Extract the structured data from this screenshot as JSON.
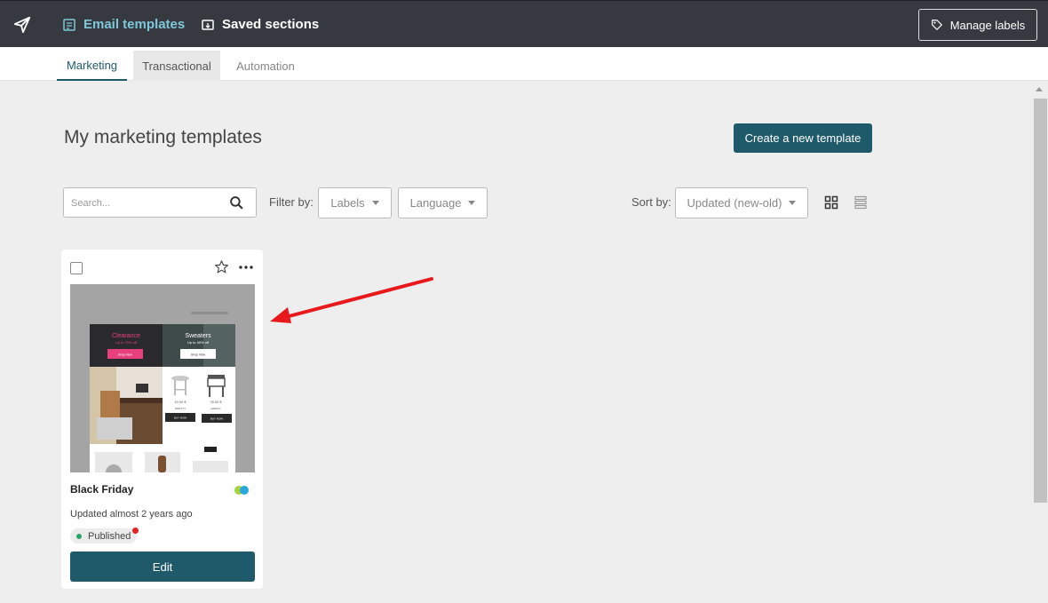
{
  "topbar": {
    "email_templates": "Email templates",
    "saved_sections": "Saved sections",
    "manage_labels": "Manage labels"
  },
  "tabs": [
    {
      "label": "Marketing",
      "active": true
    },
    {
      "label": "Transactional",
      "active": false
    },
    {
      "label": "Automation",
      "active": false
    }
  ],
  "page": {
    "title": "My marketing templates",
    "create_button": "Create a new template"
  },
  "filters": {
    "search_placeholder": "Search...",
    "filter_by": "Filter by:",
    "labels_dropdown": "Labels",
    "language_dropdown": "Language",
    "sort_by": "Sort by:",
    "sort_value": "Updated (new-old)"
  },
  "templates": [
    {
      "title": "Black Friday",
      "updated": "Updated almost 2 years ago",
      "status": "Published",
      "edit_label": "Edit",
      "thumbnail": {
        "clearance": "Clearance",
        "clearance_sub": "Up to 70% off",
        "shop_now": "Shop Now",
        "sweaters": "Sweaters",
        "sweaters_sub": "Up to 40% off",
        "price_1": "19.90 €",
        "name_1": "GRETTY",
        "price_2": "78.00 €",
        "name_2": "HARALT",
        "buy_now": "BUY NOW"
      }
    }
  ],
  "colors": {
    "topbar_bg": "#363a40",
    "accent": "#1f5a6b",
    "active_nav": "#7ec8d8",
    "published": "#2ba36a",
    "notification": "#e52222",
    "annotation_arrow": "#e8191c"
  }
}
